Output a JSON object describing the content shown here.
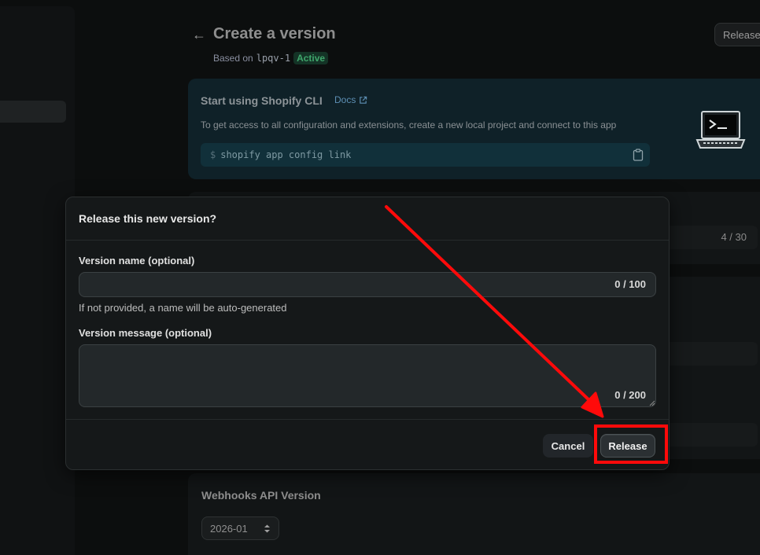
{
  "page": {
    "title": "Create a version",
    "based_on_label": "Based on",
    "based_on_version": "lpqv-1",
    "status_badge": "Active",
    "top_release_label": "Release"
  },
  "cli_card": {
    "title": "Start using Shopify CLI",
    "docs_label": "Docs",
    "description": "To get access to all configuration and extensions, create a new local project and connect to this app",
    "prompt_symbol": "$",
    "command": "shopify app config link"
  },
  "background_fields": {
    "counter": "4 / 30"
  },
  "webhooks": {
    "title": "Webhooks API Version",
    "selected_version": "2026-01"
  },
  "modal": {
    "title": "Release this new version?",
    "name_label": "Version name (optional)",
    "name_value": "",
    "name_count": "0 / 100",
    "name_help": "If not provided, a name will be auto-generated",
    "message_label": "Version message (optional)",
    "message_value": "",
    "message_count": "0 / 200",
    "cancel_label": "Cancel",
    "release_label": "Release"
  },
  "colors": {
    "annotation": "#ff0a0a",
    "active_badge_bg": "#143326",
    "active_badge_text": "#3fa56b"
  },
  "icons": {
    "back": "arrow-left-icon",
    "docs": "external-link-icon",
    "copy": "clipboard-icon",
    "illustration": "laptop-terminal-icon",
    "select": "chevron-up-down-icon"
  }
}
